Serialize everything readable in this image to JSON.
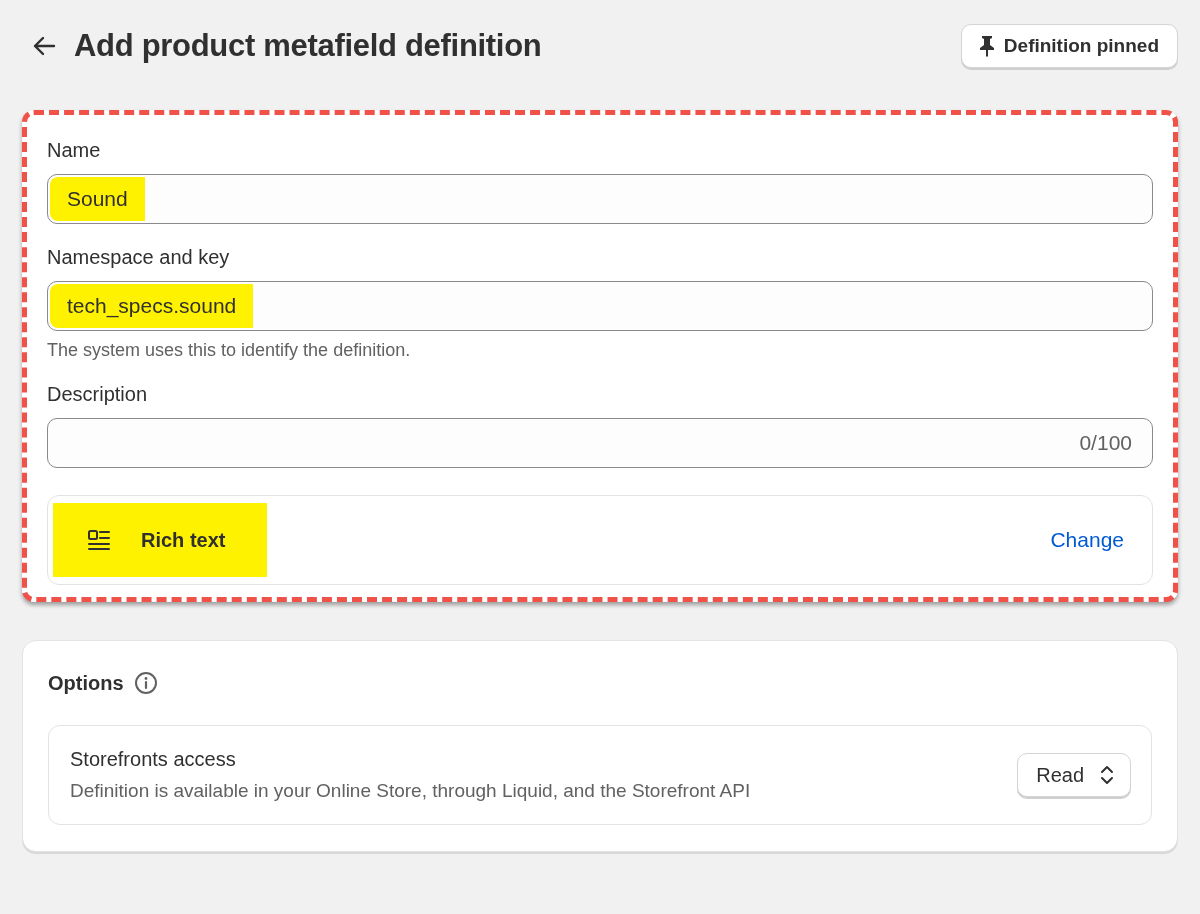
{
  "header": {
    "title": "Add product metafield definition",
    "pin_button": "Definition pinned"
  },
  "definition": {
    "annotated": true,
    "fields": [
      {
        "label": "Name",
        "value": "Sound",
        "highlighted": true
      },
      {
        "label": "Namespace and key",
        "value": "tech_specs.sound",
        "highlighted": true,
        "help": "The system uses this to identify the definition."
      },
      {
        "label": "Description",
        "counter": "0/100",
        "highlighted": false
      }
    ],
    "type": {
      "label": "Rich text",
      "highlighted": true,
      "action": "Change"
    }
  },
  "options": {
    "title": "Options",
    "access": {
      "title": "Storefronts access",
      "description": "Definition is available in your Online Store, through Liquid, and the Storefront API",
      "select": "Read"
    }
  }
}
